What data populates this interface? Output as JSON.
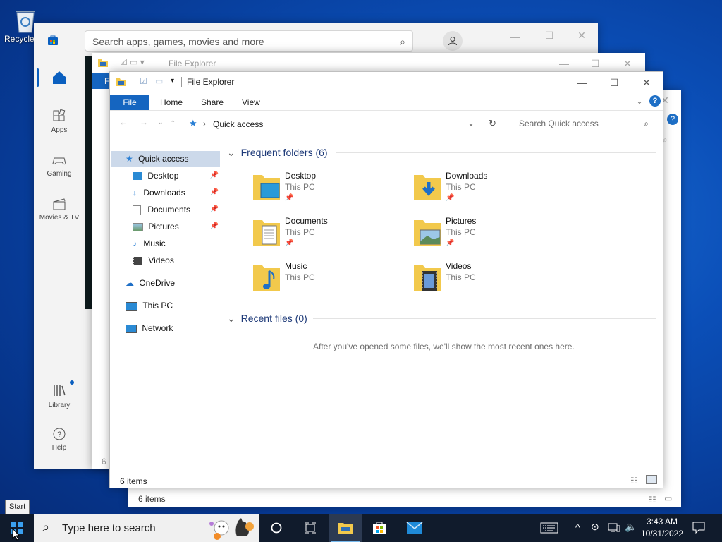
{
  "desktop": {
    "recycle_label": "Recycle"
  },
  "store": {
    "search_placeholder": "Search apps, games, movies and more",
    "nav": [
      {
        "label": "Apps"
      },
      {
        "label": "Gaming"
      },
      {
        "label": "Movies & TV"
      },
      {
        "label": "Library"
      },
      {
        "label": "Help"
      }
    ]
  },
  "back_explorer": {
    "title": "File Explorer",
    "tab_partial": "F",
    "status": "6 i"
  },
  "back_explorer2": {
    "status": "6 items"
  },
  "explorer": {
    "title": "File Explorer",
    "tabs": [
      "File",
      "Home",
      "Share",
      "View"
    ],
    "address": "Quick access",
    "search_placeholder": "Search Quick access",
    "nav": [
      {
        "label": "Quick access"
      },
      {
        "label": "Desktop"
      },
      {
        "label": "Downloads"
      },
      {
        "label": "Documents"
      },
      {
        "label": "Pictures"
      },
      {
        "label": "Music"
      },
      {
        "label": "Videos"
      },
      {
        "label": "OneDrive"
      },
      {
        "label": "This PC"
      },
      {
        "label": "Network"
      }
    ],
    "frequent_header": "Frequent folders (6)",
    "folders": [
      {
        "name": "Desktop",
        "location": "This PC"
      },
      {
        "name": "Downloads",
        "location": "This PC"
      },
      {
        "name": "Documents",
        "location": "This PC"
      },
      {
        "name": "Pictures",
        "location": "This PC"
      },
      {
        "name": "Music",
        "location": "This PC"
      },
      {
        "name": "Videos",
        "location": "This PC"
      }
    ],
    "recent_header": "Recent files (0)",
    "recent_empty": "After you've opened some files, we'll show the most recent ones here.",
    "status": "6 items"
  },
  "taskbar": {
    "start_tooltip": "Start",
    "search_placeholder": "Type here to search",
    "time": "3:43 AM",
    "date": "10/31/2022"
  },
  "colors": {
    "accent": "#1565c0",
    "taskbar": "#101b2c",
    "folder": "#f2c94c"
  }
}
